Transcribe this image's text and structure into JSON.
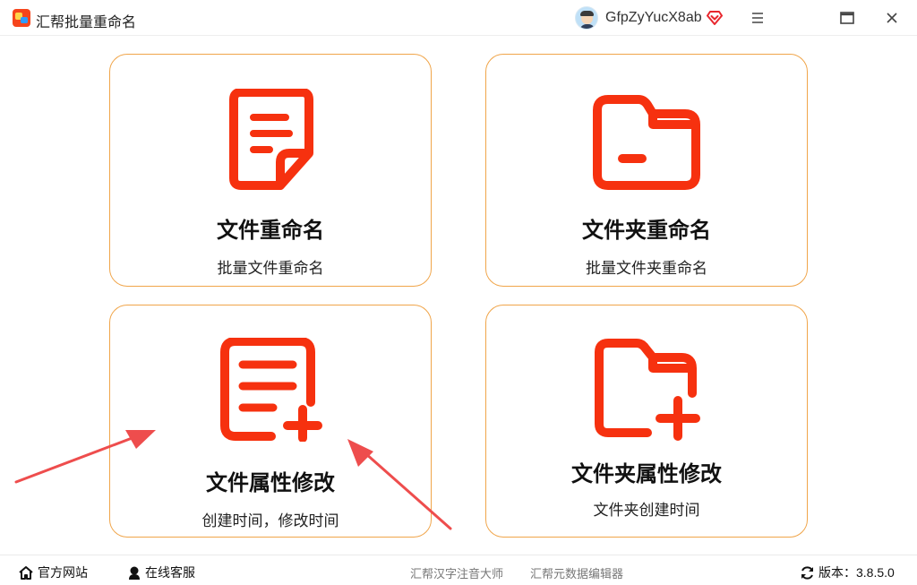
{
  "app": {
    "title": "汇帮批量重命名",
    "icon": "app-logo-icon"
  },
  "user": {
    "name": "GfpZyYucX8ab",
    "avatar": "avatar",
    "badge": "vip-diamond-icon"
  },
  "window_controls": [
    "menu-icon",
    "maximize-icon",
    "close-icon"
  ],
  "cards": [
    {
      "title": "文件重命名",
      "subtitle": "批量文件重命名",
      "icon": "file-document-icon"
    },
    {
      "title": "文件夹重命名",
      "subtitle": "批量文件夹重命名",
      "icon": "folder-icon"
    },
    {
      "title": "文件属性修改",
      "subtitle": "创建时间，修改时间",
      "icon": "file-edit-add-icon"
    },
    {
      "title": "文件夹属性修改",
      "subtitle": "文件夹创建时间",
      "icon": "folder-add-icon"
    }
  ],
  "footer": {
    "website": "官方网站",
    "support": "在线客服",
    "link1": "汇帮汉字注音大师",
    "link2": "汇帮元数据编辑器",
    "version": "版本：3.8.5.0"
  },
  "colors": {
    "accent": "#f6310f",
    "card_border": "#f0a54a",
    "annotation_arrow": "#ee4d4d"
  }
}
